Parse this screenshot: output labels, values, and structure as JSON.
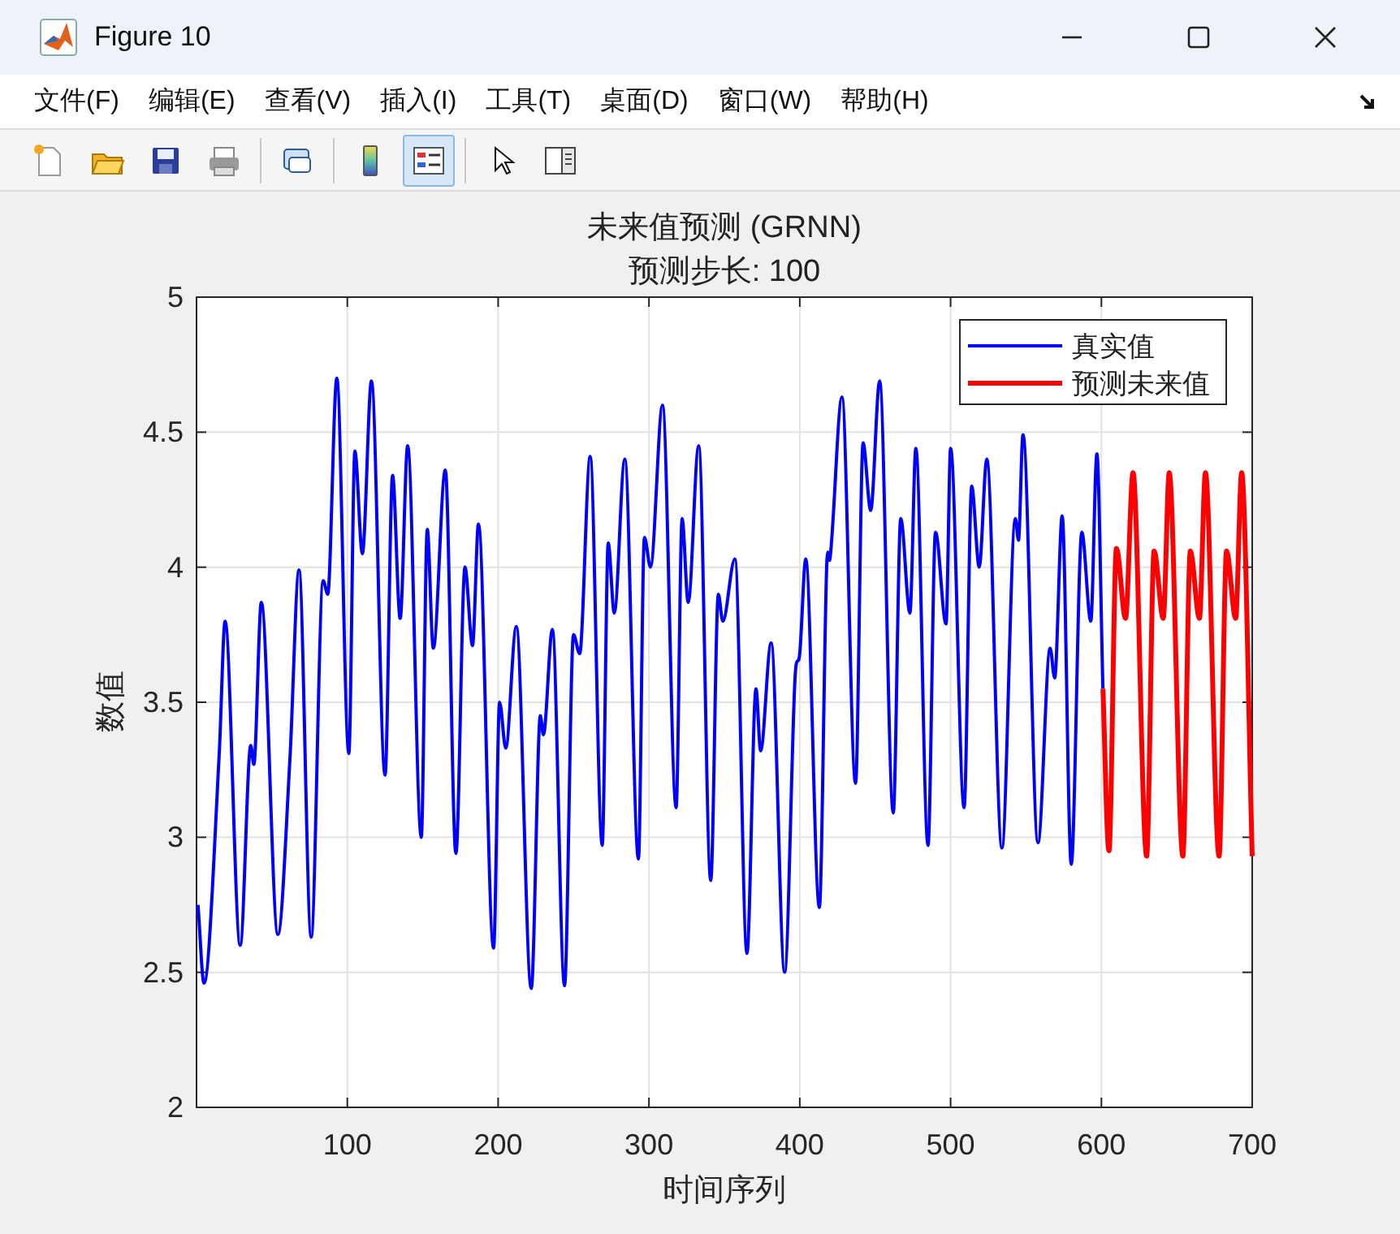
{
  "window": {
    "title": "Figure 10"
  },
  "menu": [
    "文件(F)",
    "编辑(E)",
    "查看(V)",
    "插入(I)",
    "工具(T)",
    "桌面(D)",
    "窗口(W)",
    "帮助(H)"
  ],
  "toolbar": {
    "buttons": [
      {
        "selected": false
      },
      {
        "selected": false
      },
      {
        "selected": false
      },
      {
        "selected": false
      },
      {
        "selected": false
      },
      {
        "selected": false
      },
      {
        "selected": true
      },
      {
        "selected": false
      },
      {
        "selected": false
      }
    ]
  },
  "figure": {
    "subtitle": "预测步长: 100",
    "chart_data": {
      "type": "line",
      "grid": true,
      "legend": true,
      "title": "未来值预测 (GRNN)",
      "xlabel": "时间序列",
      "ylabel": "数值",
      "xlim": [
        0,
        700
      ],
      "ylim": [
        2,
        5
      ],
      "xticks": [
        100,
        200,
        300,
        400,
        500,
        600,
        700
      ],
      "yticks": [
        2,
        2.5,
        3,
        3.5,
        4,
        4.5,
        5
      ],
      "series": [
        {
          "name": "真实值",
          "color": "#0000ff",
          "x": [
            1,
            5,
            15,
            19,
            29,
            36,
            38,
            43,
            54,
            62,
            68,
            76,
            84,
            87,
            93,
            101,
            105,
            110,
            116,
            125,
            130,
            135,
            140,
            149,
            153,
            157,
            165,
            172,
            178,
            183,
            187,
            197,
            201,
            205,
            212,
            222,
            228,
            230,
            236,
            244,
            250,
            254,
            261,
            269,
            273,
            277,
            284,
            293,
            297,
            301,
            309,
            318,
            322,
            326,
            333,
            341,
            346,
            349,
            357,
            365,
            371,
            374,
            381,
            390,
            397,
            400,
            404,
            413,
            418,
            420,
            428,
            437,
            442,
            447,
            453,
            462,
            467,
            473,
            477,
            485,
            490,
            497,
            500,
            509,
            514,
            519,
            524,
            534,
            543,
            545,
            548,
            558,
            566,
            569,
            574,
            580,
            587,
            593,
            597,
            601
          ],
          "values": [
            2.75,
            2.46,
            3.3,
            3.8,
            2.6,
            3.34,
            3.27,
            3.87,
            2.64,
            3.3,
            3.99,
            2.63,
            3.95,
            3.9,
            4.7,
            3.31,
            4.43,
            4.05,
            4.69,
            3.23,
            4.34,
            3.81,
            4.45,
            3.0,
            4.14,
            3.7,
            4.36,
            2.94,
            4.0,
            3.71,
            4.16,
            2.59,
            3.5,
            3.33,
            3.78,
            2.44,
            3.45,
            3.38,
            3.77,
            2.45,
            3.75,
            3.68,
            4.41,
            2.97,
            4.09,
            3.83,
            4.4,
            2.92,
            4.11,
            4.0,
            4.6,
            3.11,
            4.18,
            3.87,
            4.45,
            2.84,
            3.9,
            3.8,
            4.03,
            2.57,
            3.55,
            3.32,
            3.72,
            2.5,
            3.6,
            3.68,
            4.03,
            2.74,
            4.02,
            4.03,
            4.63,
            3.2,
            4.46,
            4.21,
            4.69,
            3.09,
            4.18,
            3.83,
            4.44,
            2.97,
            4.13,
            3.79,
            4.44,
            3.11,
            4.3,
            4.0,
            4.4,
            2.96,
            4.18,
            4.1,
            4.49,
            2.98,
            3.7,
            3.59,
            4.19,
            2.9,
            4.13,
            3.8,
            4.42,
            3.55
          ]
        },
        {
          "name": "预测未来值",
          "color": "#ff0000",
          "x": [
            601,
            605,
            610,
            616,
            621,
            630,
            635,
            641,
            645,
            654,
            659,
            665,
            669,
            678,
            683,
            689,
            693,
            700
          ],
          "values": [
            3.55,
            2.95,
            4.07,
            3.81,
            4.35,
            2.93,
            4.06,
            3.81,
            4.35,
            2.93,
            4.06,
            3.81,
            4.35,
            2.93,
            4.06,
            3.81,
            4.35,
            2.93
          ]
        }
      ]
    }
  }
}
